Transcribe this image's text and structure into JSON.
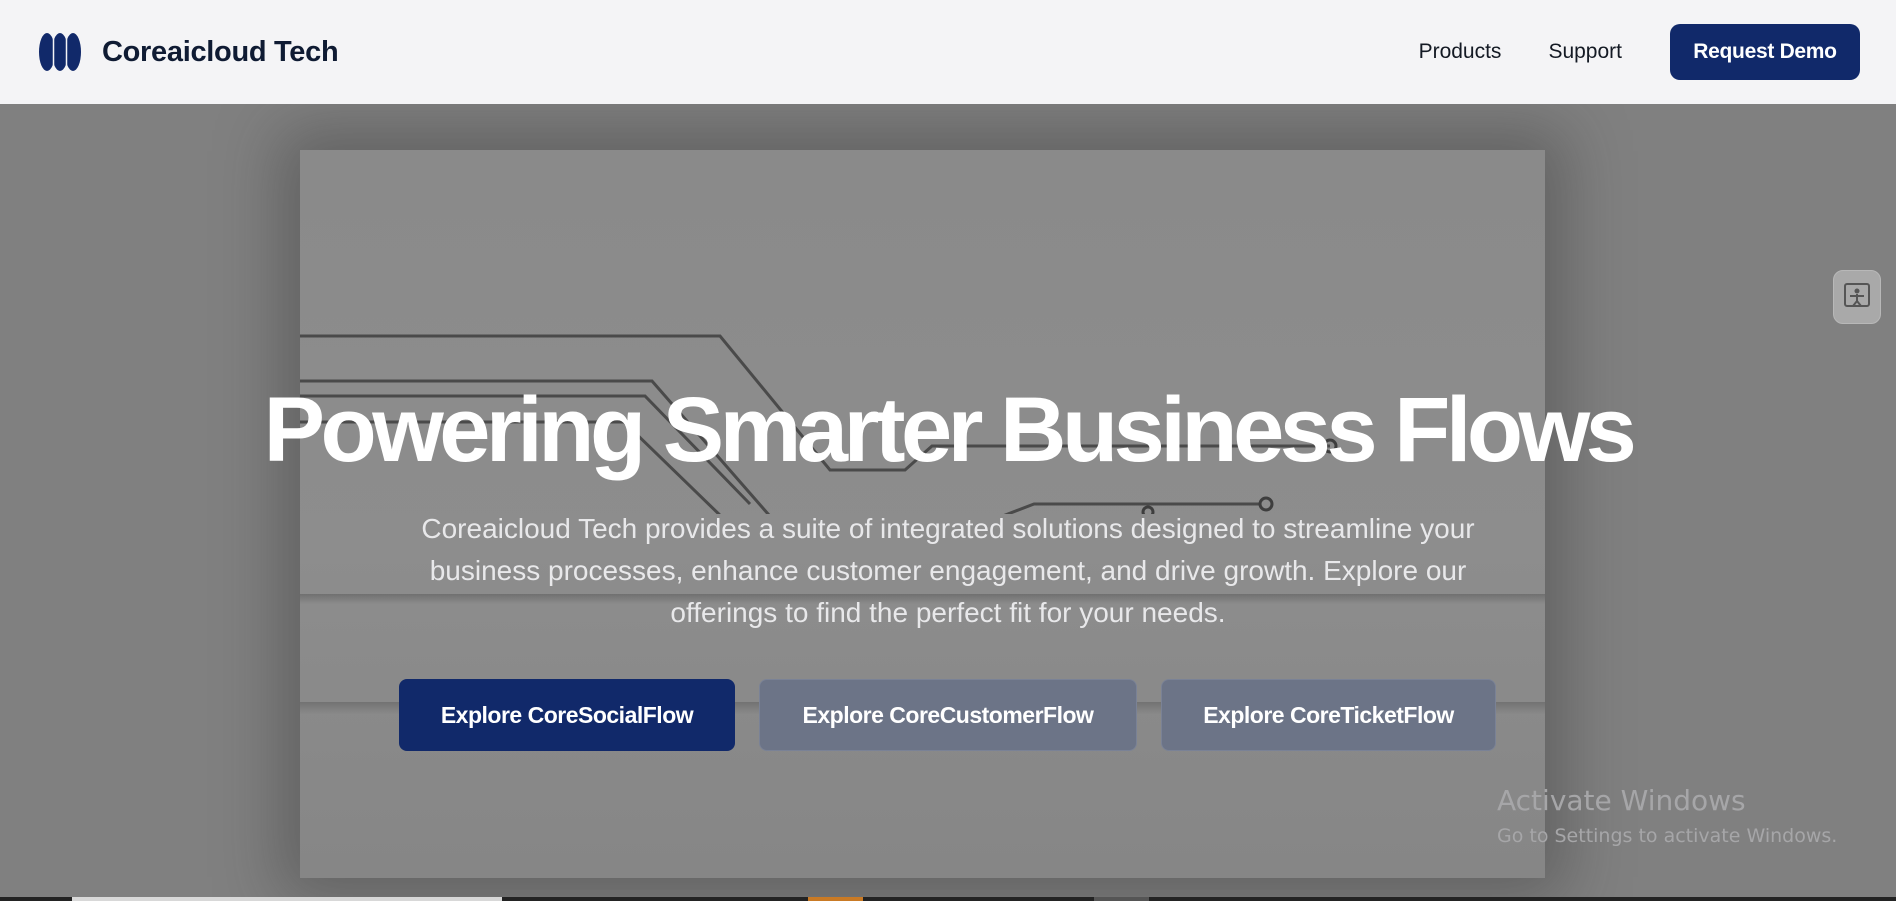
{
  "header": {
    "brand_name": "Coreaicloud Tech",
    "nav": [
      "Products",
      "Support"
    ],
    "cta_label": "Request Demo"
  },
  "hero": {
    "title": "Powering Smarter Business Flows",
    "subtitle": "Coreaicloud Tech provides a suite of integrated solutions designed to streamline your business processes, enhance customer engagement, and drive growth. Explore our offerings to find the perfect fit for your needs.",
    "buttons": [
      "Explore CoreSocialFlow",
      "Explore CoreCustomerFlow",
      "Explore CoreTicketFlow"
    ]
  },
  "watermark": {
    "title": "Activate Windows",
    "subtitle": "Go to Settings to activate Windows."
  },
  "colors": {
    "brand": "#11296a",
    "header_bg": "#f4f4f6",
    "secondary_button": "#6c7487"
  },
  "icons": {
    "logo": "brand-logo-icon",
    "side_widget": "accessibility-icon"
  }
}
